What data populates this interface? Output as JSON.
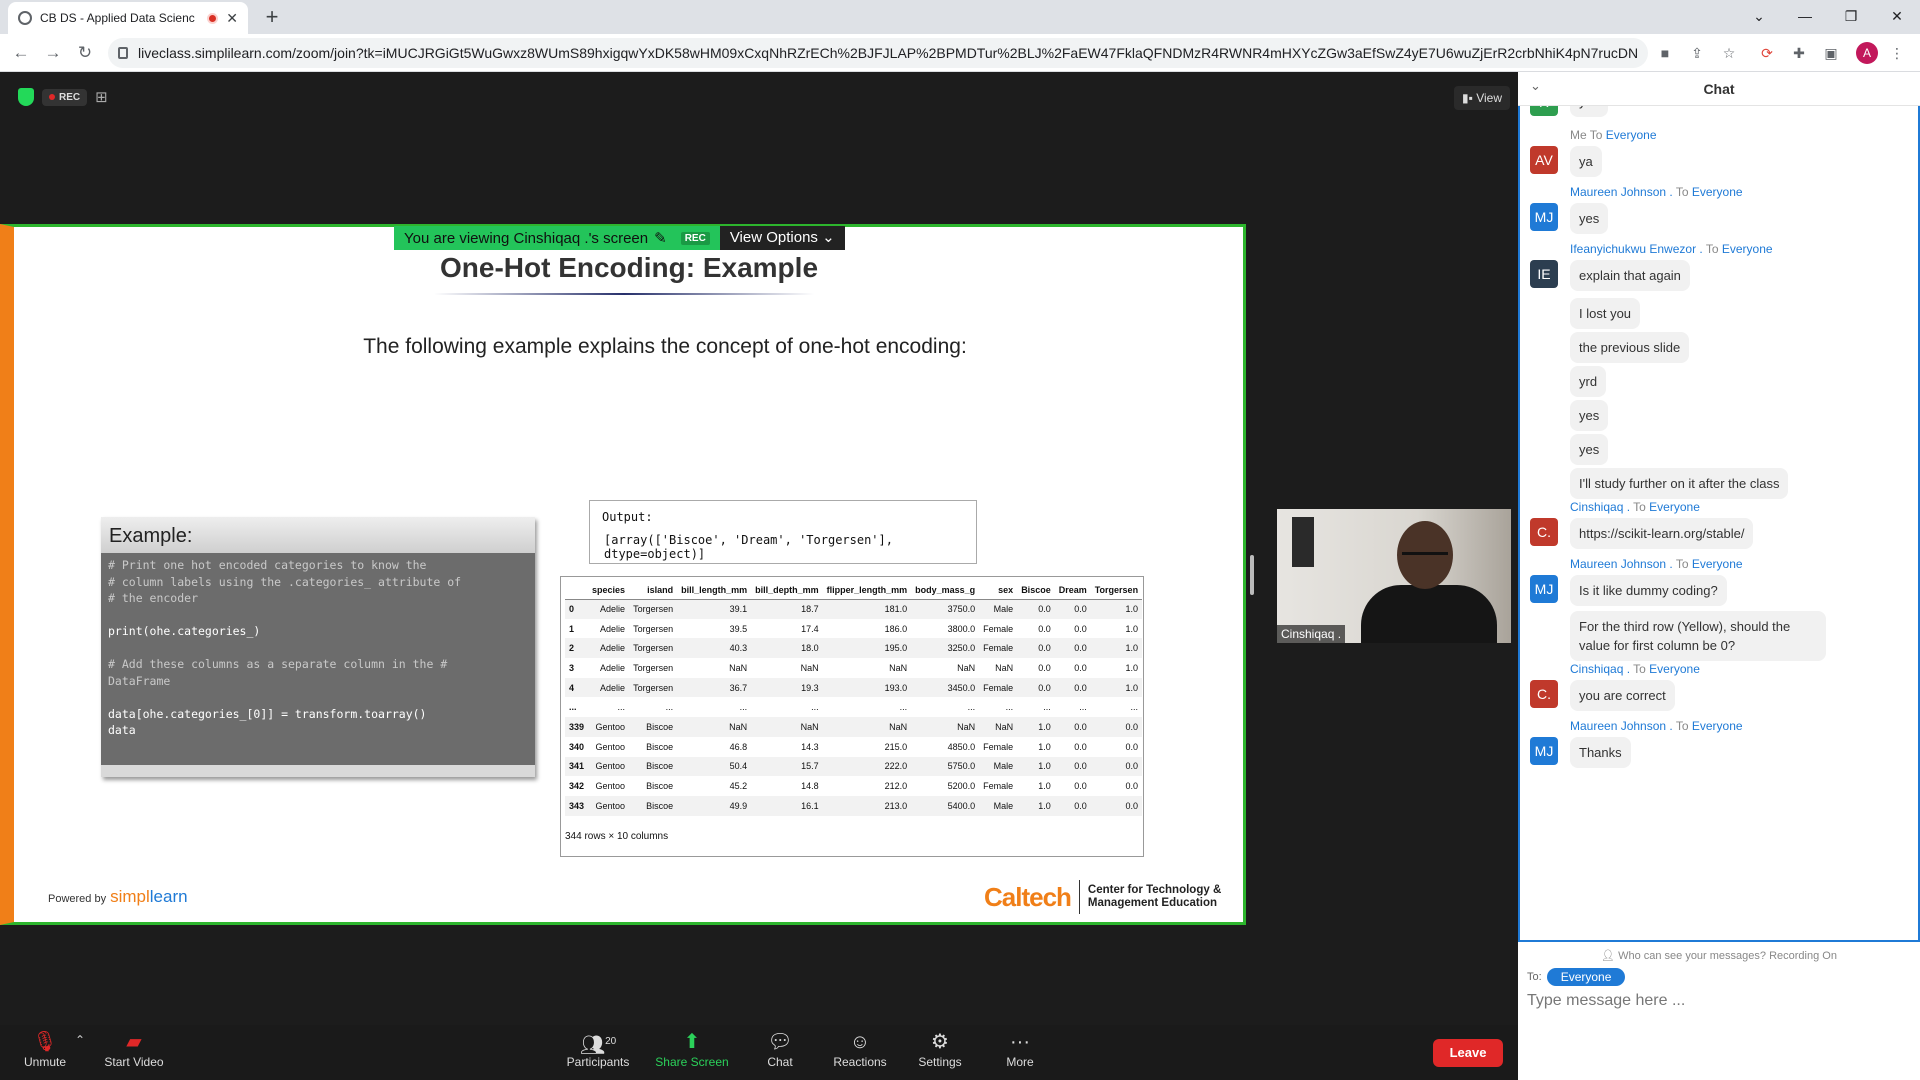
{
  "browser": {
    "tab_title": "CB DS - Applied Data Scienc",
    "url": "liveclass.simplilearn.com/zoom/join?tk=iMUCJRGiGt5WuGwxz8WUmS89hxigqwYxDK58wHM09xCxqNhRZrECh%2BJFJLAP%2BPMDTur%2BLJ%2FaEW47FklaQFNDMzR4RWNR4mHXYcZGw3aEfSwZ4yE7U6wuZjErR2crbNhiK4pN7rucDNn5pcxSOy6...",
    "profile_initial": "A"
  },
  "meeting": {
    "rec_label": "REC",
    "view_label": "View",
    "viewing_banner": "You are viewing Cinshiqaq .'s screen",
    "banner_rec": "REC",
    "view_options": "View Options"
  },
  "slide": {
    "title": "One-Hot Encoding: Example",
    "subtitle": "The following example explains the concept of one-hot encoding:",
    "example_header": "Example:",
    "code": [
      {
        "kind": "cmt",
        "text": "# Print one hot encoded categories to know the"
      },
      {
        "kind": "cmt",
        "text": "# column labels using the .categories_ attribute of"
      },
      {
        "kind": "cmt",
        "text": "# the encoder"
      },
      {
        "kind": "blank",
        "text": ""
      },
      {
        "kind": "code",
        "text": "print(ohe.categories_)"
      },
      {
        "kind": "blank",
        "text": ""
      },
      {
        "kind": "cmt",
        "text": "# Add these columns as a separate column in the #"
      },
      {
        "kind": "cmt",
        "text": "DataFrame"
      },
      {
        "kind": "blank",
        "text": ""
      },
      {
        "kind": "code",
        "text": "data[ohe.categories_[0]] = transform.toarray()"
      },
      {
        "kind": "code",
        "text": "data"
      }
    ],
    "output_label": "Output:",
    "output_value": "[array(['Biscoe', 'Dream', 'Torgersen'], dtype=object)]",
    "table_columns": [
      "",
      "species",
      "island",
      "bill_length_mm",
      "bill_depth_mm",
      "flipper_length_mm",
      "body_mass_g",
      "sex",
      "Biscoe",
      "Dream",
      "Torgersen"
    ],
    "table_rows": [
      [
        "0",
        "Adelie",
        "Torgersen",
        "39.1",
        "18.7",
        "181.0",
        "3750.0",
        "Male",
        "0.0",
        "0.0",
        "1.0"
      ],
      [
        "1",
        "Adelie",
        "Torgersen",
        "39.5",
        "17.4",
        "186.0",
        "3800.0",
        "Female",
        "0.0",
        "0.0",
        "1.0"
      ],
      [
        "2",
        "Adelie",
        "Torgersen",
        "40.3",
        "18.0",
        "195.0",
        "3250.0",
        "Female",
        "0.0",
        "0.0",
        "1.0"
      ],
      [
        "3",
        "Adelie",
        "Torgersen",
        "NaN",
        "NaN",
        "NaN",
        "NaN",
        "NaN",
        "0.0",
        "0.0",
        "1.0"
      ],
      [
        "4",
        "Adelie",
        "Torgersen",
        "36.7",
        "19.3",
        "193.0",
        "3450.0",
        "Female",
        "0.0",
        "0.0",
        "1.0"
      ],
      [
        "...",
        "...",
        "...",
        "...",
        "...",
        "...",
        "...",
        "...",
        "...",
        "...",
        "..."
      ],
      [
        "339",
        "Gentoo",
        "Biscoe",
        "NaN",
        "NaN",
        "NaN",
        "NaN",
        "NaN",
        "1.0",
        "0.0",
        "0.0"
      ],
      [
        "340",
        "Gentoo",
        "Biscoe",
        "46.8",
        "14.3",
        "215.0",
        "4850.0",
        "Female",
        "1.0",
        "0.0",
        "0.0"
      ],
      [
        "341",
        "Gentoo",
        "Biscoe",
        "50.4",
        "15.7",
        "222.0",
        "5750.0",
        "Male",
        "1.0",
        "0.0",
        "0.0"
      ],
      [
        "342",
        "Gentoo",
        "Biscoe",
        "45.2",
        "14.8",
        "212.0",
        "5200.0",
        "Female",
        "1.0",
        "0.0",
        "0.0"
      ],
      [
        "343",
        "Gentoo",
        "Biscoe",
        "49.9",
        "16.1",
        "213.0",
        "5400.0",
        "Male",
        "1.0",
        "0.0",
        "0.0"
      ]
    ],
    "table_footer": "344 rows × 10 columns",
    "powered_by": "Powered by",
    "brand_left": "simpl",
    "brand_right": "learn",
    "caltech": "Caltech",
    "ctme_line1": "Center for Technology &",
    "ctme_line2": "Management Education"
  },
  "webcam": {
    "name": "Cinshiqaq ."
  },
  "toolbar": {
    "unmute": "Unmute",
    "start_video": "Start Video",
    "participants": "Participants",
    "participants_count": "20",
    "share_screen": "Share Screen",
    "chat": "Chat",
    "reactions": "Reactions",
    "settings": "Settings",
    "more": "More",
    "leave": "Leave"
  },
  "chat": {
    "title": "Chat",
    "messages": [
      {
        "avatar": "R",
        "color": "#2e9e4f",
        "text": "yes"
      },
      {
        "avatar": "AV",
        "color": "#c0392b",
        "sender": "Me",
        "to": "To",
        "recipient": "Everyone",
        "text": "ya"
      },
      {
        "avatar": "MJ",
        "color": "#1f7ad6",
        "sender": "Maureen Johnson .",
        "to": "To",
        "recipient": "Everyone",
        "text": "yes"
      },
      {
        "avatar": "IE",
        "color": "#2c3e50",
        "sender": "Ifeanyichukwu Enwezor .",
        "to": "To",
        "recipient": "Everyone",
        "text": "explain that again"
      },
      {
        "text": "I lost you"
      },
      {
        "text": "the previous slide"
      },
      {
        "text": "yrd"
      },
      {
        "text": "yes"
      },
      {
        "text": "yes"
      },
      {
        "text": "I'll study further on it after the class"
      },
      {
        "avatar": "C.",
        "color": "#c0392b",
        "sender": "Cinshiqaq .",
        "to": "To",
        "recipient": "Everyone",
        "text": "https://scikit-learn.org/stable/"
      },
      {
        "avatar": "MJ",
        "color": "#1f7ad6",
        "sender": "Maureen Johnson .",
        "to": "To",
        "recipient": "Everyone",
        "text": "Is it like dummy coding?"
      },
      {
        "text": "For the third row (Yellow), should the value for first column be 0?"
      },
      {
        "avatar": "C.",
        "color": "#c0392b",
        "sender": "Cinshiqaq .",
        "to": "To",
        "recipient": "Everyone",
        "text": "you are correct"
      },
      {
        "avatar": "MJ",
        "color": "#1f7ad6",
        "sender": "Maureen Johnson .",
        "to": "To",
        "recipient": "Everyone",
        "text": "Thanks"
      }
    ],
    "who_can_see": "Who can see your messages? Recording On",
    "to_label": "To:",
    "to_value": "Everyone",
    "input_placeholder": "Type message here ..."
  }
}
